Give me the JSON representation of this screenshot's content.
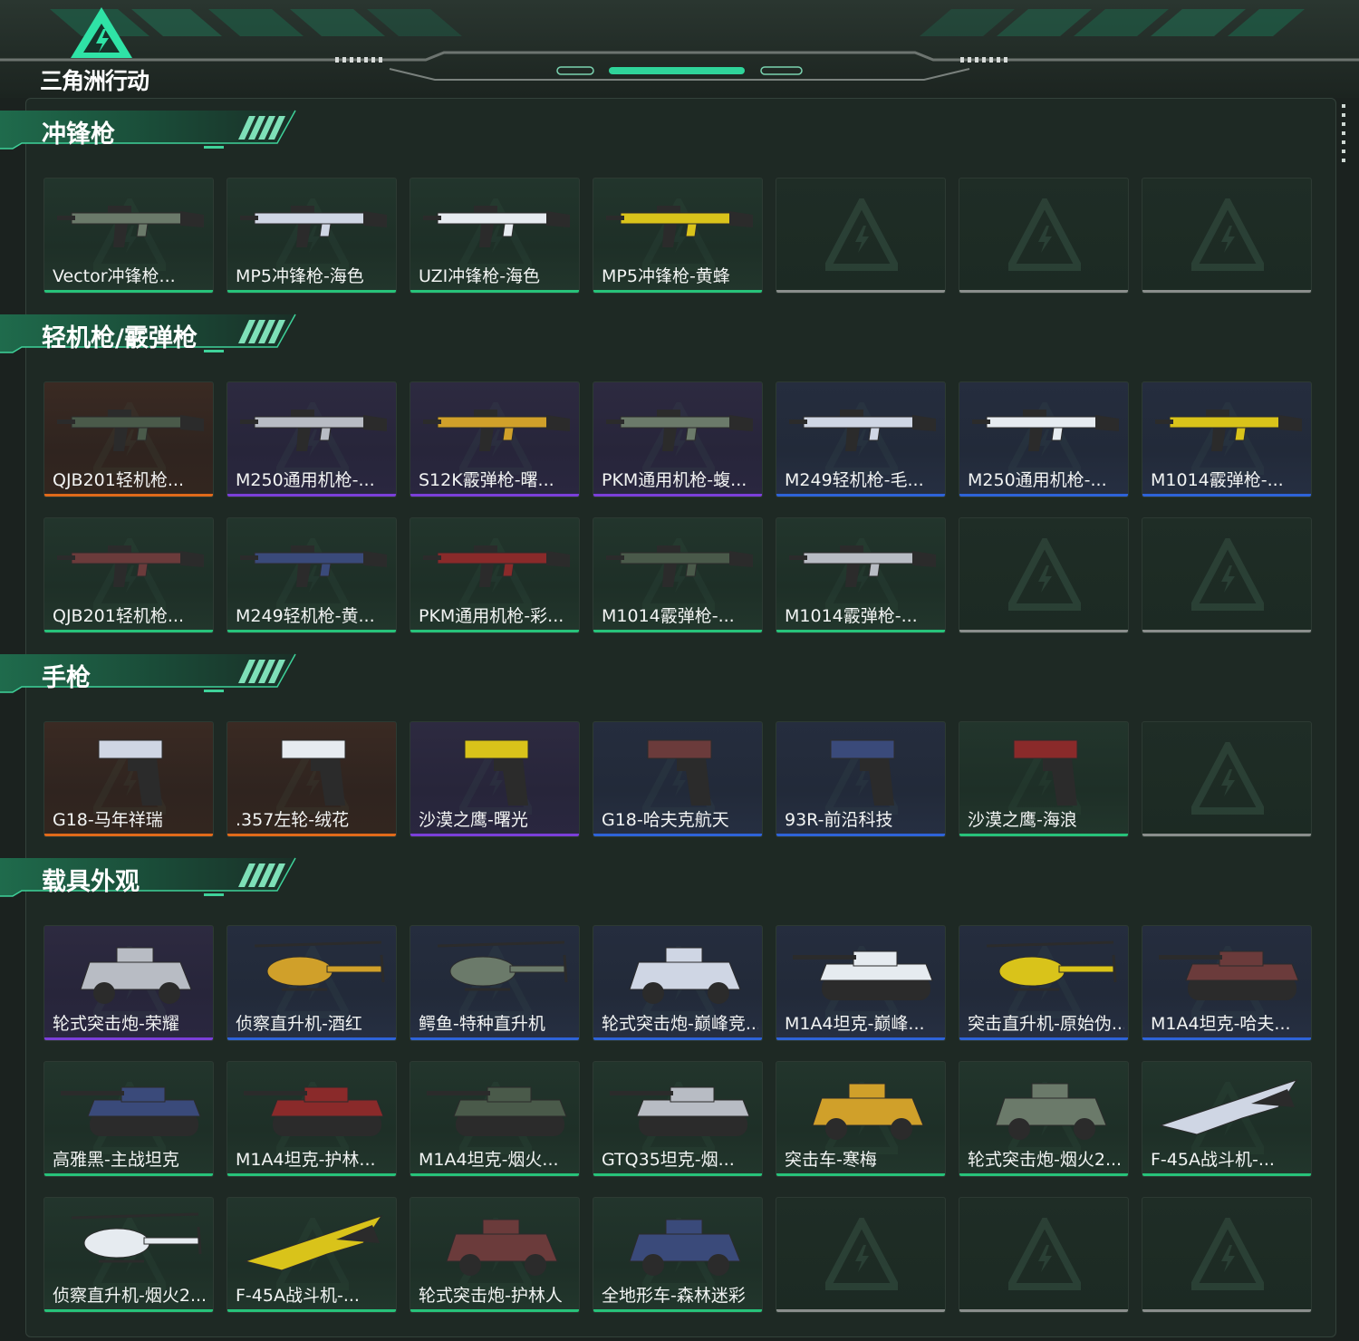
{
  "app": {
    "logo_text": "三角洲行动"
  },
  "colors": {
    "green": "#27c27a",
    "orange": "#e06a1a",
    "purple": "#7b3fd9",
    "blue": "#2e63d8",
    "empty": "#8a8e8c"
  },
  "sections": [
    {
      "title": "冲锋枪"
    },
    {
      "title": "轻机枪/霰弹枪"
    },
    {
      "title": "手枪"
    },
    {
      "title": "载具外观"
    }
  ],
  "cards": [
    {
      "label": "Vector冲锋枪...",
      "rarity": "green",
      "icon": "smg-vector-icon"
    },
    {
      "label": "MP5冲锋枪-海色",
      "rarity": "green",
      "icon": "smg-mp5-icon"
    },
    {
      "label": "UZI冲锋枪-海色",
      "rarity": "green",
      "icon": "smg-uzi-icon"
    },
    {
      "label": "MP5冲锋枪-黄蜂",
      "rarity": "green",
      "icon": "smg-mp5-icon"
    },
    {
      "label": "",
      "rarity": "empty",
      "icon": "empty-slot-icon"
    },
    {
      "label": "",
      "rarity": "empty",
      "icon": "empty-slot-icon"
    },
    {
      "label": "",
      "rarity": "empty",
      "icon": "empty-slot-icon"
    },
    {
      "label": "QJB201轻机枪...",
      "rarity": "orange",
      "icon": "lmg-icon"
    },
    {
      "label": "M250通用机枪-...",
      "rarity": "purple",
      "icon": "lmg-icon"
    },
    {
      "label": "S12K霰弹枪-曙...",
      "rarity": "purple",
      "icon": "shotgun-icon"
    },
    {
      "label": "PKM通用机枪-蝮...",
      "rarity": "purple",
      "icon": "lmg-icon"
    },
    {
      "label": "M249轻机枪-毛...",
      "rarity": "blue",
      "icon": "lmg-icon"
    },
    {
      "label": "M250通用机枪-...",
      "rarity": "blue",
      "icon": "lmg-icon"
    },
    {
      "label": "M1014霰弹枪-...",
      "rarity": "blue",
      "icon": "shotgun-icon"
    },
    {
      "label": "QJB201轻机枪...",
      "rarity": "green",
      "icon": "lmg-icon"
    },
    {
      "label": "M249轻机枪-黄...",
      "rarity": "green",
      "icon": "lmg-icon"
    },
    {
      "label": "PKM通用机枪-彩...",
      "rarity": "green",
      "icon": "lmg-icon"
    },
    {
      "label": "M1014霰弹枪-...",
      "rarity": "green",
      "icon": "shotgun-icon"
    },
    {
      "label": "M1014霰弹枪-...",
      "rarity": "green",
      "icon": "shotgun-icon"
    },
    {
      "label": "",
      "rarity": "empty",
      "icon": "empty-slot-icon"
    },
    {
      "label": "",
      "rarity": "empty",
      "icon": "empty-slot-icon"
    },
    {
      "label": "G18-马年祥瑞",
      "rarity": "orange",
      "icon": "pistol-icon"
    },
    {
      "label": ".357左轮-绒花",
      "rarity": "orange",
      "icon": "revolver-icon"
    },
    {
      "label": "沙漠之鹰-曙光",
      "rarity": "purple",
      "icon": "pistol-icon"
    },
    {
      "label": "G18-哈夫克航天",
      "rarity": "blue",
      "icon": "pistol-icon"
    },
    {
      "label": "93R-前沿科技",
      "rarity": "blue",
      "icon": "pistol-icon"
    },
    {
      "label": "沙漠之鹰-海浪",
      "rarity": "green",
      "icon": "pistol-icon"
    },
    {
      "label": "",
      "rarity": "empty",
      "icon": "empty-slot-icon"
    },
    {
      "label": "轮式突击炮-荣耀",
      "rarity": "purple",
      "icon": "armored-car-icon"
    },
    {
      "label": "侦察直升机-酒红",
      "rarity": "blue",
      "icon": "helicopter-icon"
    },
    {
      "label": "鳄鱼-特种直升机",
      "rarity": "blue",
      "icon": "helicopter-icon"
    },
    {
      "label": "轮式突击炮-巅峰竞...",
      "rarity": "blue",
      "icon": "armored-car-icon"
    },
    {
      "label": "M1A4坦克-巅峰...",
      "rarity": "blue",
      "icon": "tank-icon"
    },
    {
      "label": "突击直升机-原始伪...",
      "rarity": "blue",
      "icon": "helicopter-icon"
    },
    {
      "label": "M1A4坦克-哈夫...",
      "rarity": "blue",
      "icon": "tank-icon"
    },
    {
      "label": "高雅黑-主战坦克",
      "rarity": "green",
      "icon": "tank-icon"
    },
    {
      "label": "M1A4坦克-护林...",
      "rarity": "green",
      "icon": "tank-icon"
    },
    {
      "label": "M1A4坦克-烟火...",
      "rarity": "green",
      "icon": "tank-icon"
    },
    {
      "label": "GTQ35坦克-烟...",
      "rarity": "green",
      "icon": "tank-icon"
    },
    {
      "label": "突击车-寒梅",
      "rarity": "green",
      "icon": "armored-car-icon"
    },
    {
      "label": "轮式突击炮-烟火2...",
      "rarity": "green",
      "icon": "armored-car-icon"
    },
    {
      "label": "F-45A战斗机-...",
      "rarity": "green",
      "icon": "jet-icon"
    },
    {
      "label": "侦察直升机-烟火2...",
      "rarity": "green",
      "icon": "helicopter-icon"
    },
    {
      "label": "F-45A战斗机-...",
      "rarity": "green",
      "icon": "jet-icon"
    },
    {
      "label": "轮式突击炮-护林人",
      "rarity": "green",
      "icon": "armored-car-icon"
    },
    {
      "label": "全地形车-森林迷彩",
      "rarity": "green",
      "icon": "atv-icon"
    },
    {
      "label": "",
      "rarity": "empty",
      "icon": "empty-slot-icon"
    },
    {
      "label": "",
      "rarity": "empty",
      "icon": "empty-slot-icon"
    },
    {
      "label": "",
      "rarity": "empty",
      "icon": "empty-slot-icon"
    }
  ]
}
